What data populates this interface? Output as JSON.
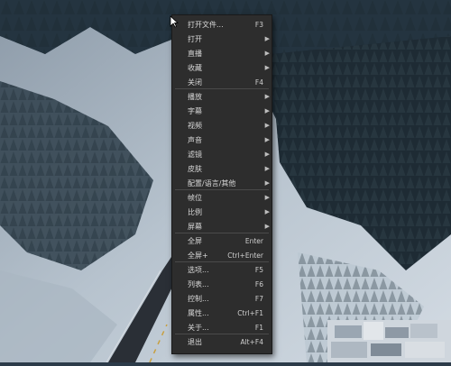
{
  "menu": {
    "items": [
      {
        "label": "打开文件...",
        "shortcut": "F3",
        "submenu": false
      },
      {
        "label": "打开",
        "shortcut": "",
        "submenu": true
      },
      {
        "label": "直播",
        "shortcut": "",
        "submenu": true
      },
      {
        "label": "收藏",
        "shortcut": "",
        "submenu": true
      },
      {
        "label": "关闭",
        "shortcut": "F4",
        "submenu": false
      },
      {
        "label": "播放",
        "shortcut": "",
        "submenu": true
      },
      {
        "label": "字幕",
        "shortcut": "",
        "submenu": true
      },
      {
        "label": "视频",
        "shortcut": "",
        "submenu": true
      },
      {
        "label": "声音",
        "shortcut": "",
        "submenu": true
      },
      {
        "label": "滤镜",
        "shortcut": "",
        "submenu": true
      },
      {
        "label": "皮肤",
        "shortcut": "",
        "submenu": true
      },
      {
        "label": "配置/语言/其他",
        "shortcut": "",
        "submenu": true
      },
      {
        "label": "帧位",
        "shortcut": "",
        "submenu": true
      },
      {
        "label": "比例",
        "shortcut": "",
        "submenu": true
      },
      {
        "label": "屏幕",
        "shortcut": "",
        "submenu": true
      },
      {
        "label": "全屏",
        "shortcut": "Enter",
        "submenu": false
      },
      {
        "label": "全屏+",
        "shortcut": "Ctrl+Enter",
        "submenu": false
      },
      {
        "label": "选项...",
        "shortcut": "F5",
        "submenu": false
      },
      {
        "label": "列表...",
        "shortcut": "F6",
        "submenu": false
      },
      {
        "label": "控制...",
        "shortcut": "F7",
        "submenu": false
      },
      {
        "label": "属性...",
        "shortcut": "Ctrl+F1",
        "submenu": false
      },
      {
        "label": "关于...",
        "shortcut": "F1",
        "submenu": false
      },
      {
        "label": "退出",
        "shortcut": "Alt+F4",
        "submenu": false
      }
    ],
    "arrow_glyph": "▶"
  },
  "colors": {
    "menu_bg": "#2d2d2d",
    "menu_text": "#d9d9d9",
    "separator": "#4a4a4a",
    "snow": "#c7d2dc",
    "forest": "#1d2a33",
    "road": "#2a2f36"
  }
}
